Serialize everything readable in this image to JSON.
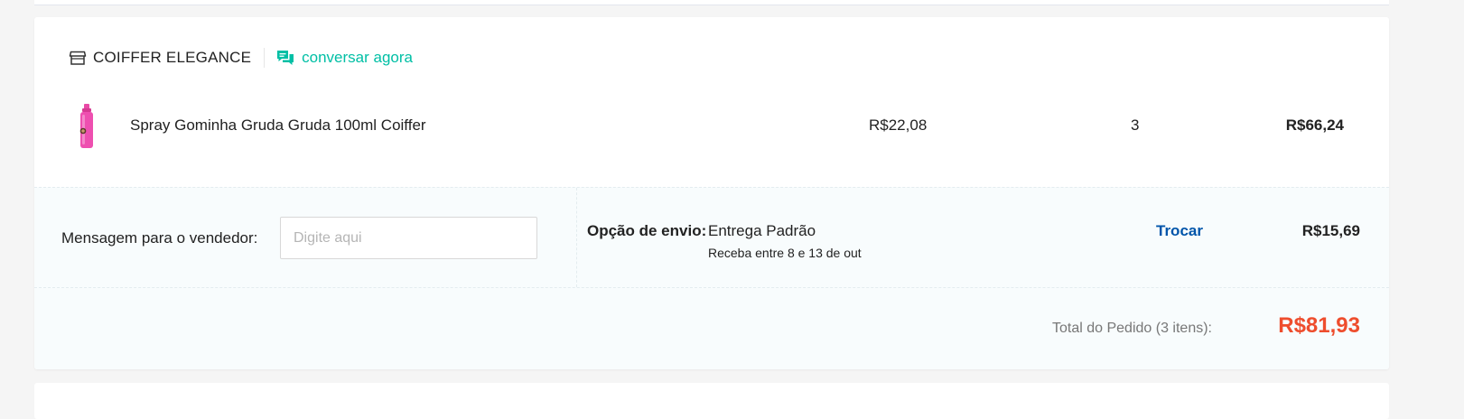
{
  "shop": {
    "name": "COIFFER ELEGANCE",
    "chat_label": "conversar agora",
    "shop_icon": "store-icon",
    "chat_icon": "chat-bubbles-icon"
  },
  "product": {
    "name": "Spray Gominha Gruda Gruda 100ml Coiffer",
    "unit_price": "R$22,08",
    "quantity": "3",
    "subtotal": "R$66,24",
    "thumb_icon": "pink-spray-bottle-image"
  },
  "message": {
    "label": "Mensagem para o vendedor:",
    "placeholder": "Digite aqui",
    "value": ""
  },
  "shipping": {
    "label": "Opção de envio:",
    "method": "Entrega Padrão",
    "estimate": "Receba entre 8 e 13 de out",
    "change_label": "Trocar",
    "price": "R$15,69"
  },
  "order_total": {
    "label": "Total do Pedido (3 itens):",
    "value": "R$81,93"
  },
  "colors": {
    "accent_teal": "#00bfa5",
    "link_blue": "#0055aa",
    "price_orange": "#ee4d2d",
    "info_bg": "#f8fcfd"
  }
}
